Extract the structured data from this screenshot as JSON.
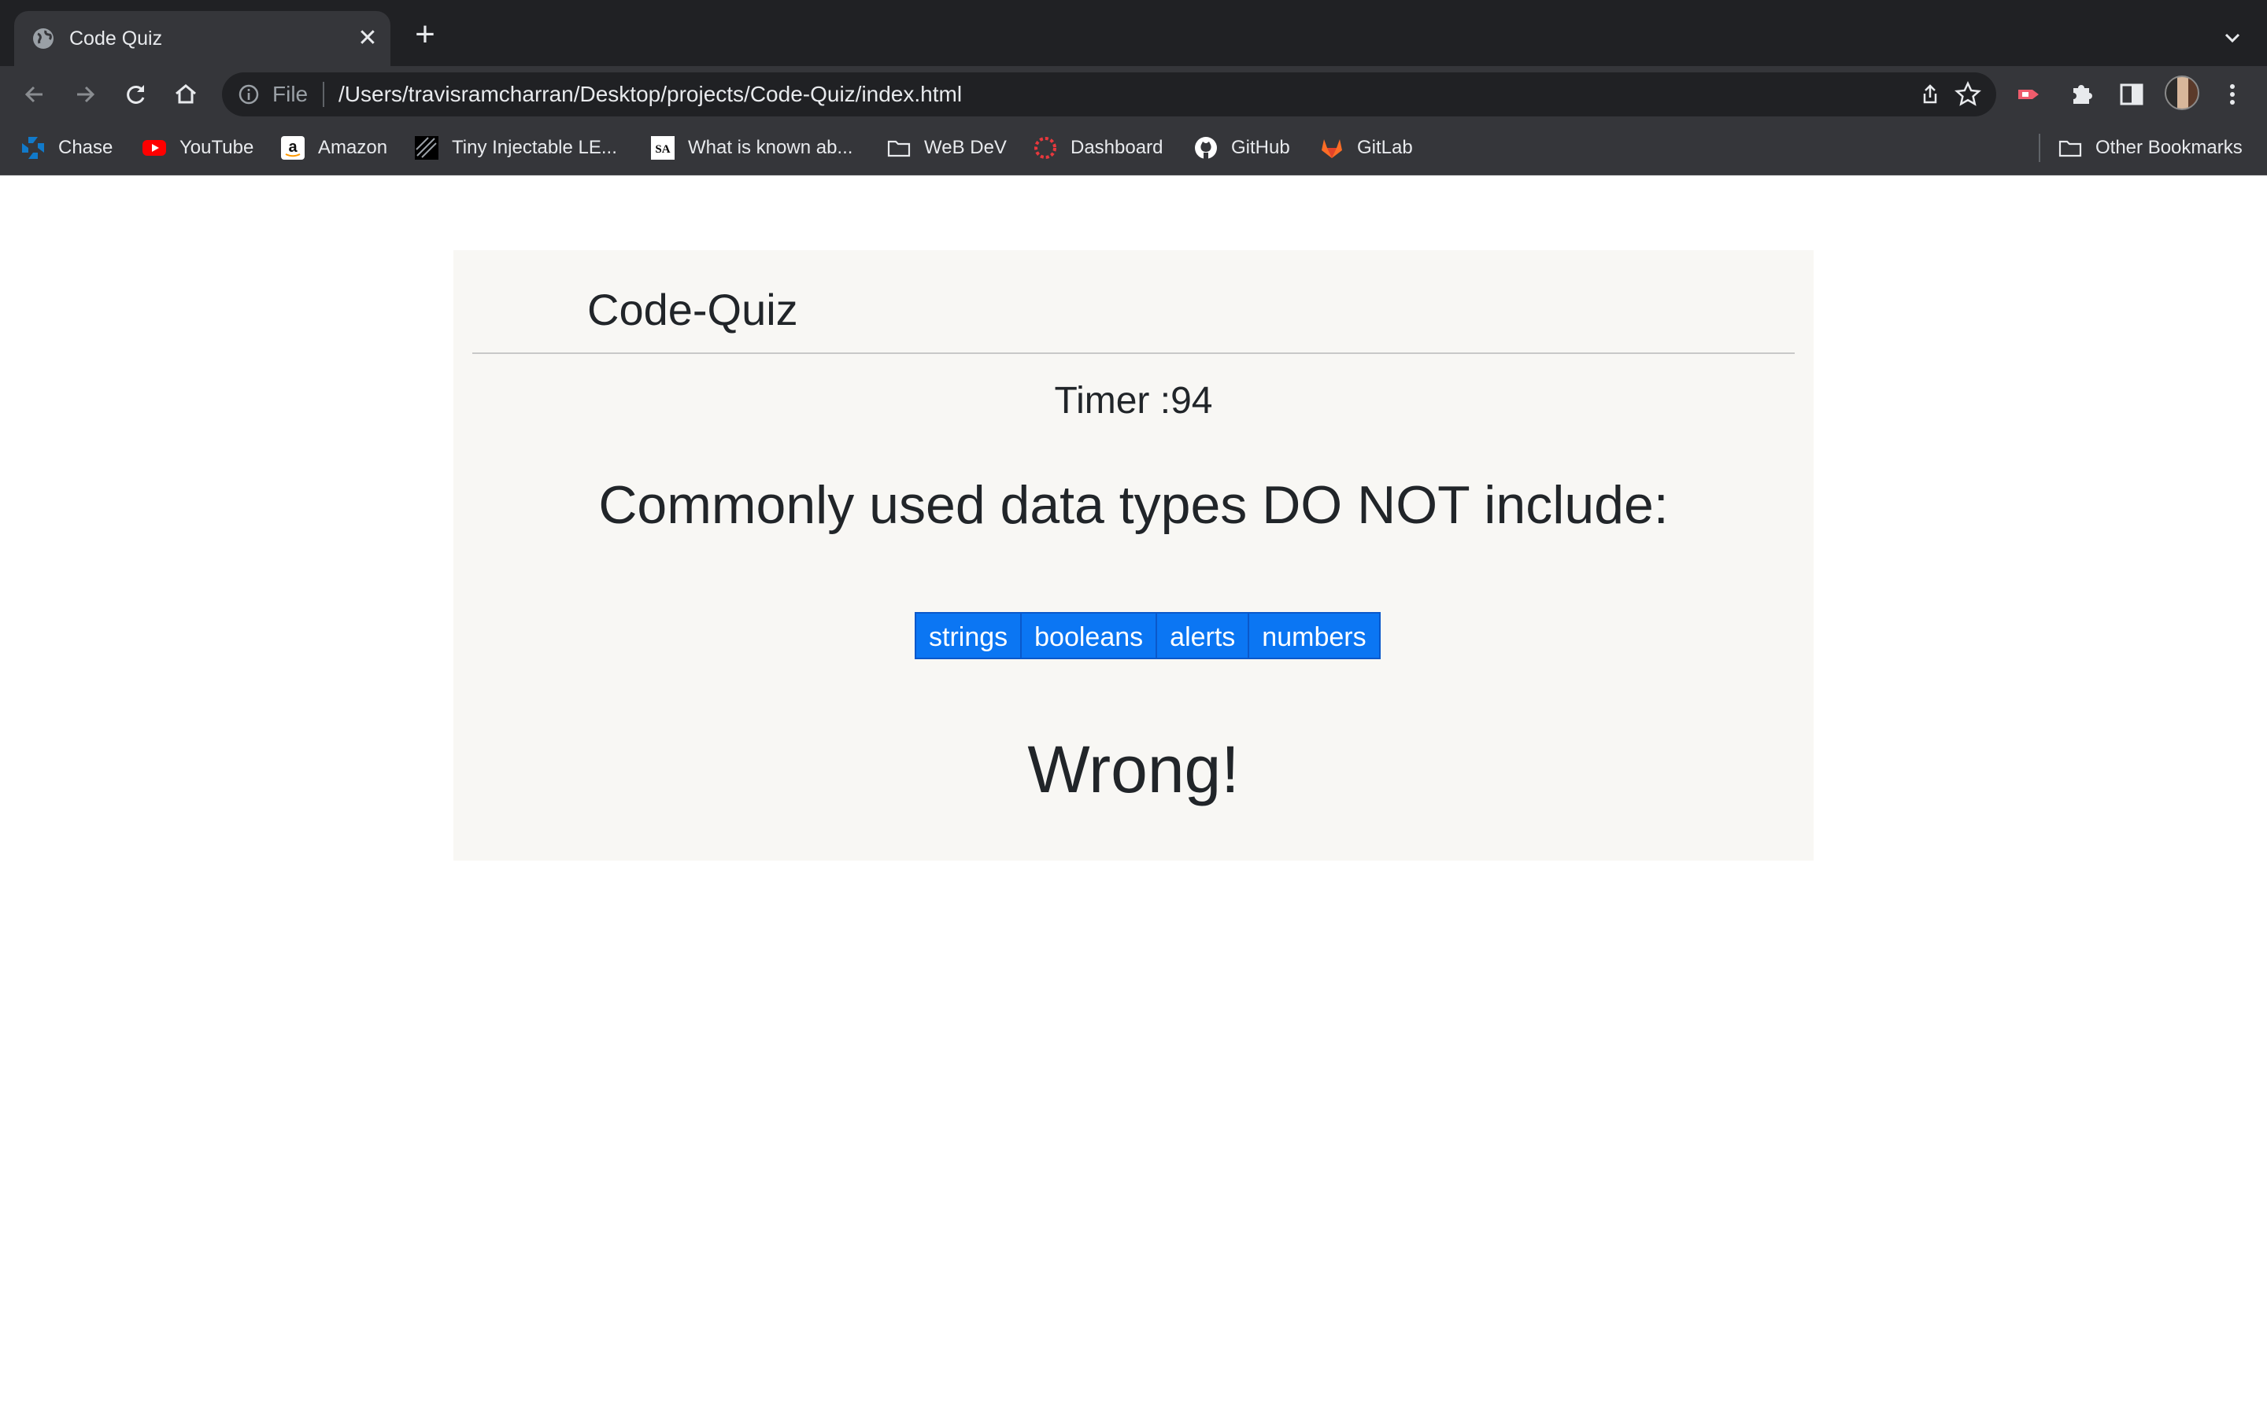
{
  "browser": {
    "tab_title": "Code Quiz",
    "tab_close": "✕",
    "new_tab": "+",
    "url_scheme": "File",
    "url": "/Users/travisramcharran/Desktop/projects/Code-Quiz/index.html"
  },
  "bookmarks": {
    "items": [
      {
        "label": "Chase",
        "icon": "chase-icon",
        "color": "#117aca"
      },
      {
        "label": "YouTube",
        "icon": "youtube-icon",
        "color": "#ff0000"
      },
      {
        "label": "Amazon",
        "icon": "amazon-icon",
        "color": "#ffffff"
      },
      {
        "label": "Tiny Injectable LE...",
        "icon": "tiny-injectable-icon",
        "color": "#000000"
      },
      {
        "label": "What is known ab...",
        "icon": "sa-icon",
        "color": "#ffffff"
      },
      {
        "label": "WeB DeV",
        "icon": "folder-icon",
        "color": "#e8eaed"
      },
      {
        "label": "Dashboard",
        "icon": "dashboard-icon",
        "color": "#e8383d"
      },
      {
        "label": "GitHub",
        "icon": "github-icon",
        "color": "#ffffff"
      },
      {
        "label": "GitLab",
        "icon": "gitlab-icon",
        "color": "#fc6d26"
      }
    ],
    "other_label": "Other Bookmarks"
  },
  "quiz": {
    "title": "Code-Quiz",
    "timer": "Timer :94",
    "question": "Commonly used data types DO NOT include:",
    "choices": [
      "strings",
      "booleans",
      "alerts",
      "numbers"
    ],
    "result": "Wrong!",
    "accent": "#0b76f3"
  }
}
